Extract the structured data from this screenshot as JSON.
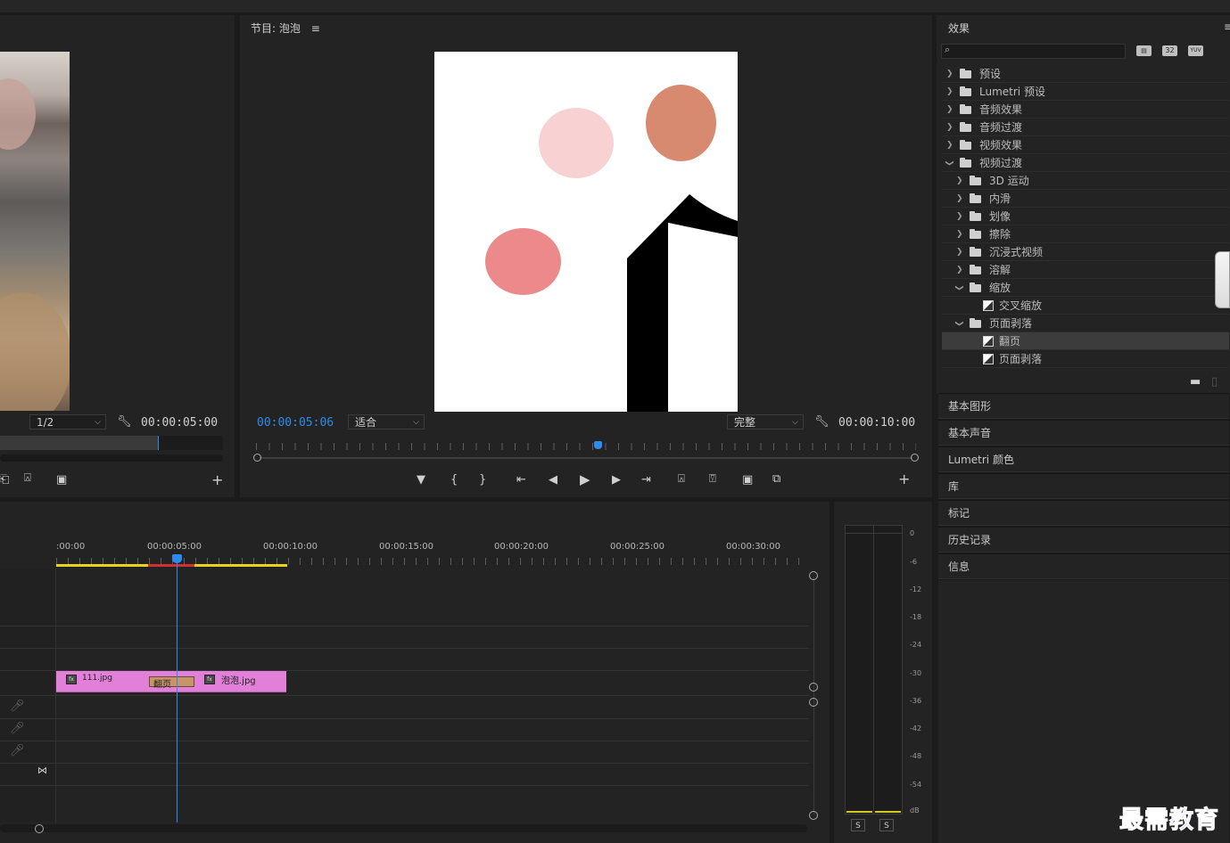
{
  "source_monitor": {
    "scale": "1/2",
    "duration": "00:00:05:00"
  },
  "program_monitor": {
    "title": "节目: 泡泡",
    "menu_icon": "hamburger-icon",
    "current_time": "00:00:05:06",
    "fit": "适合",
    "quality": "完整",
    "duration": "00:00:10:00"
  },
  "effects_panel": {
    "title": "效果",
    "search_placeholder": "",
    "filter_badges": [
      "accelerated-icon",
      "32",
      "YUV"
    ],
    "tree": [
      {
        "label": "预设",
        "type": "preset",
        "level": 0,
        "expanded": false
      },
      {
        "label": "Lumetri 预设",
        "type": "preset",
        "level": 0,
        "expanded": false
      },
      {
        "label": "音频效果",
        "type": "folder",
        "level": 0,
        "expanded": false
      },
      {
        "label": "音频过渡",
        "type": "folder",
        "level": 0,
        "expanded": false
      },
      {
        "label": "视频效果",
        "type": "folder",
        "level": 0,
        "expanded": false
      },
      {
        "label": "视频过渡",
        "type": "folder",
        "level": 0,
        "expanded": true
      },
      {
        "label": "3D 运动",
        "type": "folder",
        "level": 1,
        "expanded": false
      },
      {
        "label": "内滑",
        "type": "folder",
        "level": 1,
        "expanded": false
      },
      {
        "label": "划像",
        "type": "folder",
        "level": 1,
        "expanded": false
      },
      {
        "label": "擦除",
        "type": "folder",
        "level": 1,
        "expanded": false
      },
      {
        "label": "沉浸式视频",
        "type": "folder",
        "level": 1,
        "expanded": false
      },
      {
        "label": "溶解",
        "type": "folder",
        "level": 1,
        "expanded": false
      },
      {
        "label": "缩放",
        "type": "folder",
        "level": 1,
        "expanded": true
      },
      {
        "label": "交叉缩放",
        "type": "transition",
        "level": 2
      },
      {
        "label": "页面剥落",
        "type": "folder",
        "level": 1,
        "expanded": true
      },
      {
        "label": "翻页",
        "type": "transition",
        "level": 2,
        "selected": true
      },
      {
        "label": "页面剥落",
        "type": "transition",
        "level": 2
      }
    ]
  },
  "panels": [
    "基本图形",
    "基本声音",
    "Lumetri 颜色",
    "库",
    "标记",
    "历史记录",
    "信息"
  ],
  "timeline": {
    "ruler_labels": [
      ":00:00",
      "00:00:05:00",
      "00:00:10:00",
      "00:00:15:00",
      "00:00:20:00",
      "00:00:25:00",
      "00:00:30:00"
    ],
    "clips": [
      {
        "name": "111.jpg",
        "badge": "fx"
      },
      {
        "name": "泡泡.jpg",
        "badge": "fx"
      }
    ],
    "transition_label": "翻页",
    "playhead_seconds": 5.2
  },
  "audio_meter": {
    "scale": [
      "0",
      "-6",
      "-12",
      "-18",
      "-24",
      "-30",
      "-36",
      "-42",
      "-48",
      "-54",
      "dB"
    ],
    "solo_buttons": [
      "S",
      "S"
    ]
  },
  "watermark": "最需教育",
  "colors": {
    "accent_blue": "#2d8ceb",
    "clip_pink": "#e17fd9",
    "bubble_light": "#f8d2d3",
    "bubble_orange": "#d88a70",
    "bubble_red": "#ec8a8b"
  }
}
